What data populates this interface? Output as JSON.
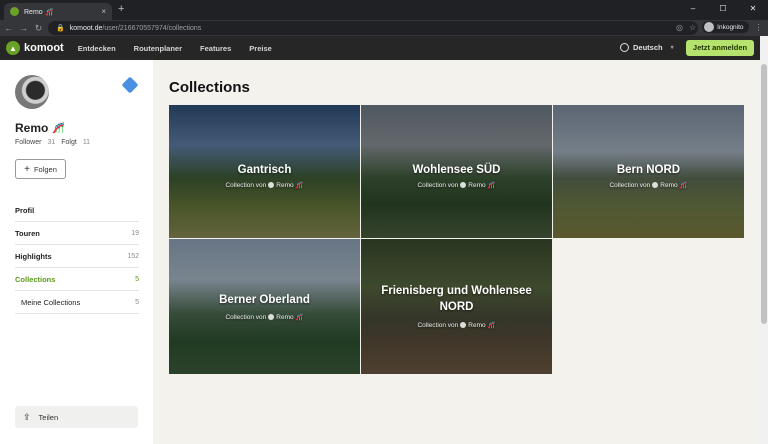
{
  "browser": {
    "tab_title": "Remo 🎢",
    "tab_close": "×",
    "new_tab": "+",
    "url_host": "komoot.de",
    "url_path": "/user/216670557974/collections",
    "incognito_label": "Inkognito",
    "win_min": "–",
    "win_max": "☐",
    "win_close": "✕"
  },
  "header": {
    "logo_text": "komoot",
    "nav": [
      "Entdecken",
      "Routenplaner",
      "Features",
      "Preise"
    ],
    "language": "Deutsch",
    "cta": "Jetzt anmelden"
  },
  "profile": {
    "name": "Remo",
    "follower_label": "Follower",
    "follower_count": "31",
    "following_label": "Folgt",
    "following_count": "11",
    "follow_button": "Folgen",
    "share_label": "Teilen"
  },
  "menu": [
    {
      "label": "Profil",
      "count": ""
    },
    {
      "label": "Touren",
      "count": "19"
    },
    {
      "label": "Highlights",
      "count": "152"
    },
    {
      "label": "Collections",
      "count": "5"
    },
    {
      "label": "Meine Collections",
      "count": "5"
    }
  ],
  "page_title": "Collections",
  "collections": [
    {
      "title": "Gantrisch",
      "subtitle_prefix": "Collection von",
      "author": "Remo 🎢"
    },
    {
      "title": "Wohlensee SÜD",
      "subtitle_prefix": "Collection von",
      "author": "Remo 🎢"
    },
    {
      "title": "Bern NORD",
      "subtitle_prefix": "Collection von",
      "author": "Remo 🎢"
    },
    {
      "title": "Berner Oberland",
      "subtitle_prefix": "Collection von",
      "author": "Remo 🎢"
    },
    {
      "title": "Frienisberg und Wohlensee NORD",
      "subtitle_prefix": "Collection von",
      "author": "Remo 🎢"
    }
  ],
  "colors": {
    "brand_green": "#6aa127",
    "cta_green": "#b6e36e",
    "active_menu": "#5b9a1b"
  }
}
